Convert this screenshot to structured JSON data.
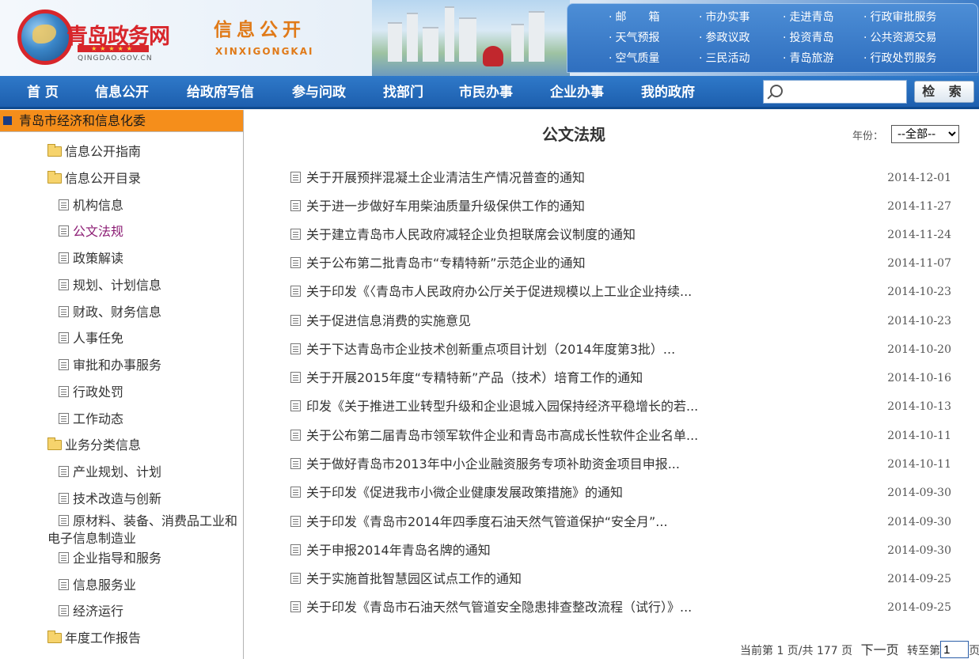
{
  "header": {
    "site_name": "青岛政务网",
    "site_url": "QINGDAO.GOV.CN",
    "section_title": "信息公开",
    "section_pinyin": "XINXIGONGKAI",
    "quicklinks": [
      "邮　　箱",
      "市办实事",
      "走进青岛",
      "行政审批服务",
      "天气预报",
      "参政议政",
      "投资青岛",
      "公共资源交易",
      "空气质量",
      "三民活动",
      "青岛旅游",
      "行政处罚服务"
    ]
  },
  "nav": {
    "items": [
      "首 页",
      "信息公开",
      "给政府写信",
      "参与问政",
      "找部门",
      "市民办事",
      "企业办事",
      "我的政府"
    ],
    "search_value": "",
    "search_button": "检 索"
  },
  "sidebar": {
    "title": "青岛市经济和信息化委",
    "items": [
      {
        "label": "信息公开指南",
        "icon": "folder-icon"
      },
      {
        "label": "信息公开目录",
        "icon": "folder-icon"
      },
      {
        "label": "机构信息",
        "icon": "doc-icon"
      },
      {
        "label": "公文法规",
        "icon": "doc-icon",
        "selected": true
      },
      {
        "label": "政策解读",
        "icon": "doc-icon"
      },
      {
        "label": "规划、计划信息",
        "icon": "doc-icon"
      },
      {
        "label": "财政、财务信息",
        "icon": "doc-icon"
      },
      {
        "label": "人事任免",
        "icon": "doc-icon"
      },
      {
        "label": "审批和办事服务",
        "icon": "doc-icon"
      },
      {
        "label": "行政处罚",
        "icon": "doc-icon"
      },
      {
        "label": "工作动态",
        "icon": "doc-icon"
      },
      {
        "label": "业务分类信息",
        "icon": "folder-icon"
      },
      {
        "label": "产业规划、计划",
        "icon": "doc-icon"
      },
      {
        "label": "技术改造与创新",
        "icon": "doc-icon"
      },
      {
        "label": "原材料、装备、消费品工业和电子信息制造业",
        "icon": "doc-icon"
      },
      {
        "label": "企业指导和服务",
        "icon": "doc-icon"
      },
      {
        "label": "信息服务业",
        "icon": "doc-icon"
      },
      {
        "label": "经济运行",
        "icon": "doc-icon"
      },
      {
        "label": "年度工作报告",
        "icon": "folder-icon"
      }
    ]
  },
  "main": {
    "title": "公文法规",
    "year_label": "年份：",
    "year_selected": "--全部--",
    "documents": [
      {
        "title": "关于开展预拌混凝土企业清洁生产情况普查的通知",
        "date": "2014-12-01"
      },
      {
        "title": "关于进一步做好车用柴油质量升级保供工作的通知",
        "date": "2014-11-27"
      },
      {
        "title": "关于建立青岛市人民政府减轻企业负担联席会议制度的通知",
        "date": "2014-11-24"
      },
      {
        "title": "关于公布第二批青岛市“专精特新”示范企业的通知",
        "date": "2014-11-07"
      },
      {
        "title": "关于印发《〈青岛市人民政府办公厅关于促进规模以上工业企业持续...",
        "date": "2014-10-23"
      },
      {
        "title": "关于促进信息消费的实施意见",
        "date": "2014-10-23"
      },
      {
        "title": "关于下达青岛市企业技术创新重点项目计划（2014年度第3批）...",
        "date": "2014-10-20"
      },
      {
        "title": "关于开展2015年度“专精特新”产品（技术）培育工作的通知",
        "date": "2014-10-16"
      },
      {
        "title": "印发《关于推进工业转型升级和企业退城入园保持经济平稳增长的若...",
        "date": "2014-10-13"
      },
      {
        "title": "关于公布第二届青岛市领军软件企业和青岛市高成长性软件企业名单...",
        "date": "2014-10-11"
      },
      {
        "title": "关于做好青岛市2013年中小企业融资服务专项补助资金项目申报...",
        "date": "2014-10-11"
      },
      {
        "title": "关于印发《促进我市小微企业健康发展政策措施》的通知",
        "date": "2014-09-30"
      },
      {
        "title": "关于印发《青岛市2014年四季度石油天然气管道保护“安全月”...",
        "date": "2014-09-30"
      },
      {
        "title": "关于申报2014年青岛名牌的通知",
        "date": "2014-09-30"
      },
      {
        "title": "关于实施首批智慧园区试点工作的通知",
        "date": "2014-09-25"
      },
      {
        "title": "关于印发《青岛市石油天然气管道安全隐患排查整改流程（试行）》...",
        "date": "2014-09-25"
      }
    ],
    "pager": {
      "status": "当前第 1 页/共 177 页",
      "next": "下一页",
      "goto_prefix": "转至第",
      "goto_value": "1",
      "goto_suffix": "页"
    }
  },
  "colors": {
    "nav_blue": "#1d5fae",
    "sidebar_orange": "#f58e1b",
    "selected_purple": "#8c1d74",
    "brand_red": "#d8262b"
  }
}
